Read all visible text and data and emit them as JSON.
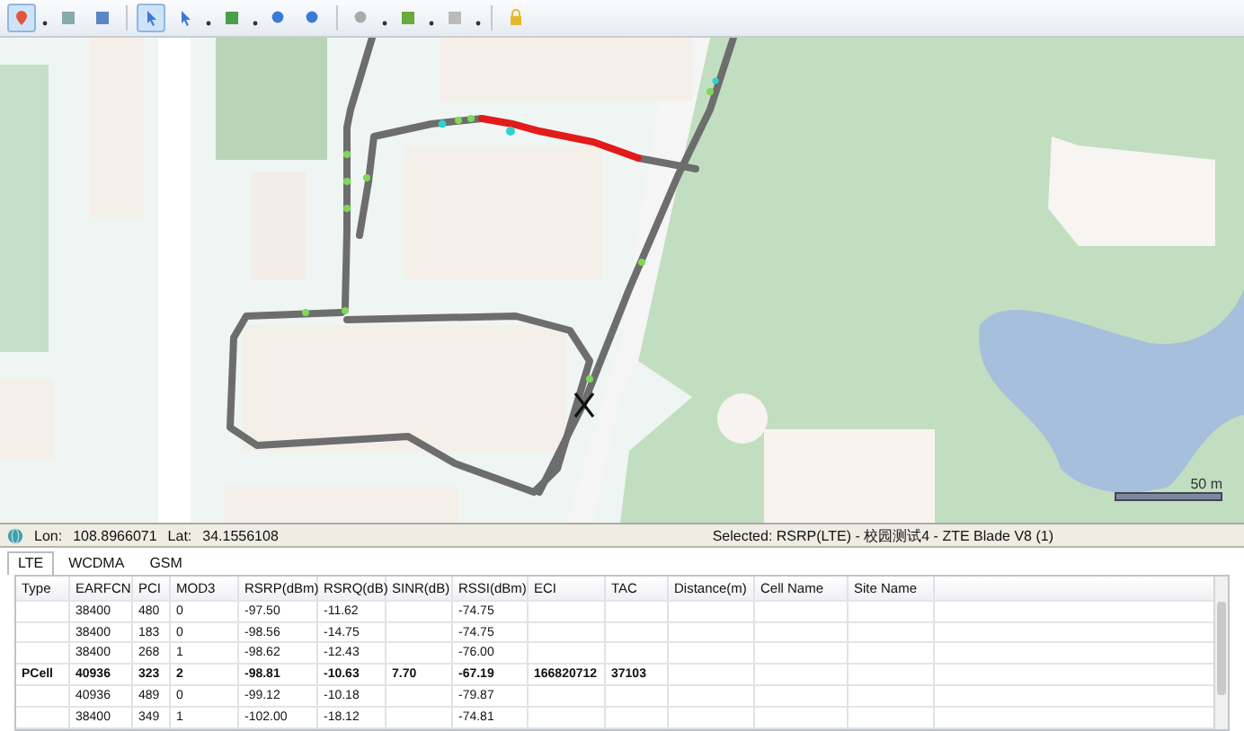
{
  "map": {
    "scale_label": "50 m"
  },
  "status_bar": {
    "lon_label": "Lon:",
    "lon": "108.8966071",
    "lat_label": "Lat:",
    "lat": "34.1556108",
    "selected": "Selected: RSRP(LTE) - 校园测试4 - ZTE Blade V8 (1)"
  },
  "tabs": [
    {
      "label": "LTE",
      "selected": true
    },
    {
      "label": "WCDMA",
      "selected": false
    },
    {
      "label": "GSM",
      "selected": false
    }
  ],
  "table": {
    "columns": [
      "Type",
      "EARFCN",
      "PCI",
      "MOD3",
      "RSRP(dBm)",
      "RSRQ(dB)",
      "SINR(dB)",
      "RSSI(dBm)",
      "ECI",
      "TAC",
      "Distance(m)",
      "Cell Name",
      "Site Name"
    ],
    "rows": [
      {
        "bold": false,
        "earfcn": "38400",
        "pci": "480",
        "mod3": "0",
        "rsrp": "-97.50",
        "rsrq": "-11.62",
        "rssi": "-74.75"
      },
      {
        "bold": false,
        "earfcn": "38400",
        "pci": "183",
        "mod3": "0",
        "rsrp": "-98.56",
        "rsrq": "-14.75",
        "rssi": "-74.75"
      },
      {
        "bold": false,
        "earfcn": "38400",
        "pci": "268",
        "mod3": "1",
        "rsrp": "-98.62",
        "rsrq": "-12.43",
        "rssi": "-76.00"
      },
      {
        "bold": true,
        "type": "PCell",
        "earfcn": "40936",
        "pci": "323",
        "mod3": "2",
        "rsrp": "-98.81",
        "rsrq": "-10.63",
        "sinr": "7.70",
        "rssi": "-67.19",
        "eci": "166820712",
        "tac": "37103"
      },
      {
        "bold": false,
        "earfcn": "40936",
        "pci": "489",
        "mod3": "0",
        "rsrp": "-99.12",
        "rsrq": "-10.18",
        "rssi": "-79.87"
      },
      {
        "bold": false,
        "earfcn": "38400",
        "pci": "349",
        "mod3": "1",
        "rsrp": "-102.00",
        "rsrq": "-18.12",
        "rssi": "-74.81"
      }
    ]
  }
}
